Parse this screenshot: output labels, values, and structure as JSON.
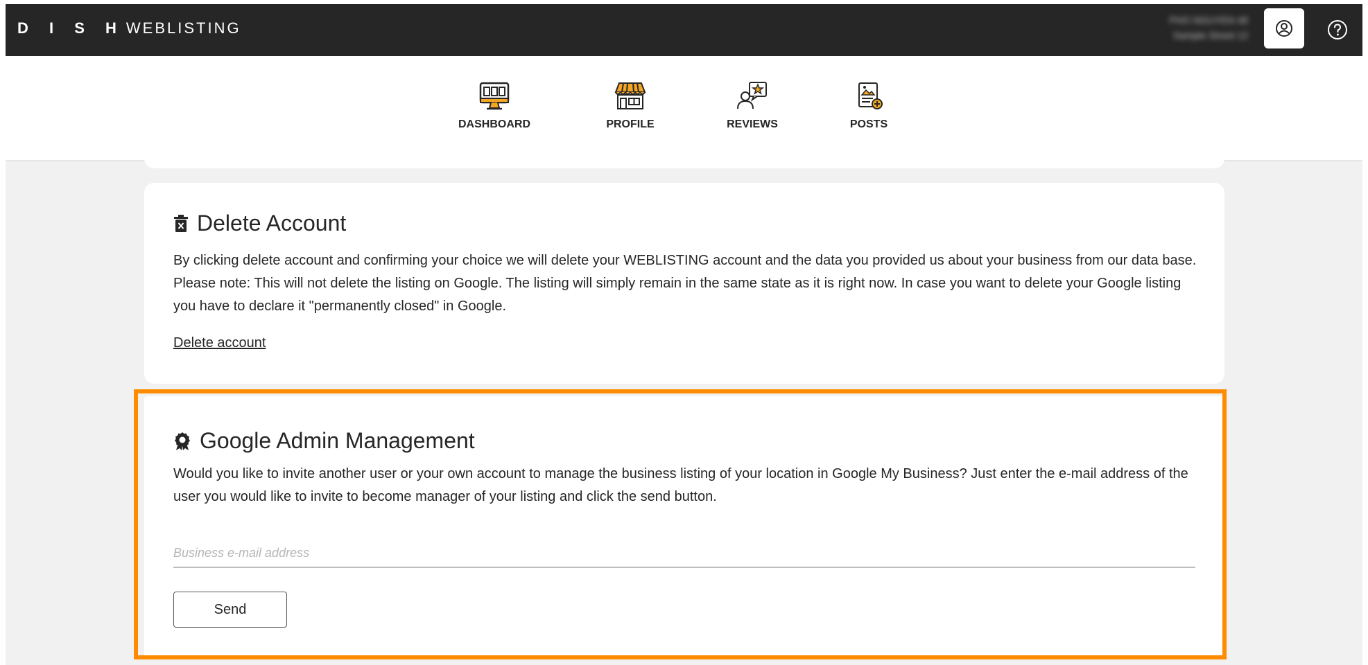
{
  "header": {
    "brand_dish": "D I S H",
    "brand_weblisting": "WEBLISTING",
    "account_name": "PHO NGUYEN 48",
    "account_address": "Sample Street 12"
  },
  "nav": {
    "items": [
      {
        "label": "DASHBOARD",
        "icon": "dashboard-monitor-icon"
      },
      {
        "label": "PROFILE",
        "icon": "storefront-icon"
      },
      {
        "label": "REVIEWS",
        "icon": "review-star-icon"
      },
      {
        "label": "POSTS",
        "icon": "post-add-icon"
      }
    ]
  },
  "delete_account": {
    "title": "Delete Account",
    "description": "By clicking delete account and confirming your choice we will delete your WEBLISTING account and the data you provided us about your business from our data base. Please note: This will not delete the listing on Google. The listing will simply remain in the same state as it is right now. In case you want to delete your Google listing you have to declare it \"permanently closed\" in Google.",
    "link_label": "Delete account"
  },
  "google_admin": {
    "title": "Google Admin Management",
    "description": "Would you like to invite another user or your own account to manage the business listing of your location in Google My Business? Just enter the e-mail address of the user you would like to invite to become manager of your listing and click the send button.",
    "email_placeholder": "Business e-mail address",
    "email_value": "",
    "send_label": "Send"
  },
  "colors": {
    "topbar": "#262626",
    "accent": "#ff8c00",
    "icon_yellow": "#f5a623"
  }
}
